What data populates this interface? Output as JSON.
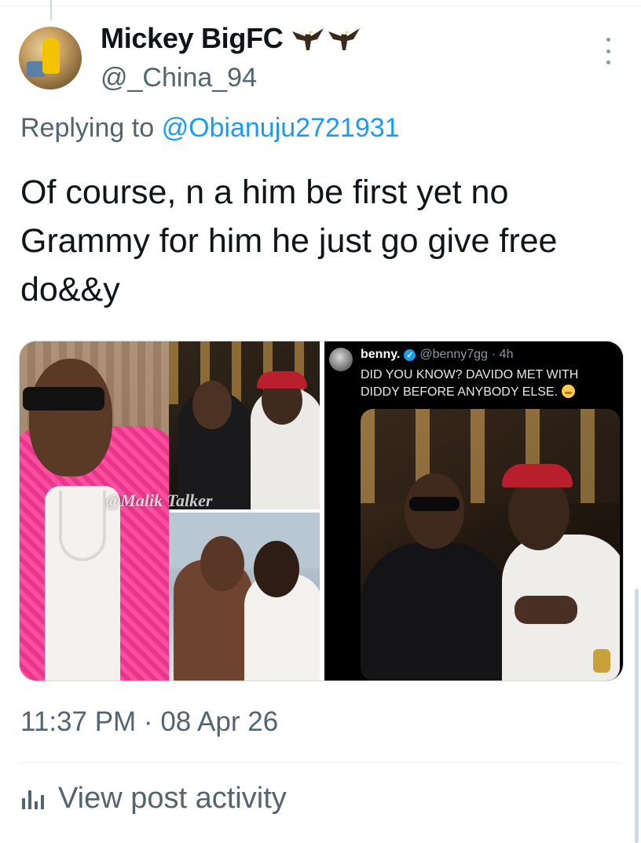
{
  "author": {
    "display_name": "Mickey BigFC",
    "handle": "@_China_94",
    "name_badges": [
      "eagle-emoji",
      "eagle-emoji"
    ]
  },
  "reply": {
    "prefix": "Replying to",
    "mention": "@Obianuju2721931"
  },
  "tweet": {
    "text": "Of course, n a him be first yet no Grammy for him he just go give free do&&y"
  },
  "media": {
    "left_watermark": "@Malik Talker",
    "embedded_post": {
      "name": "benny.",
      "handle": "@benny7gg",
      "time": "· 4h",
      "text": "DID YOU KNOW? DAVIDO MET WITH DIDDY BEFORE ANYBODY ELSE."
    }
  },
  "meta": {
    "timestamp": "11:37 PM · 08 Apr 26"
  },
  "actions": {
    "view_activity": "View post activity"
  },
  "colors": {
    "link": "#1d9bf0",
    "secondary_text": "#536471",
    "primary_text": "#0f1419"
  }
}
